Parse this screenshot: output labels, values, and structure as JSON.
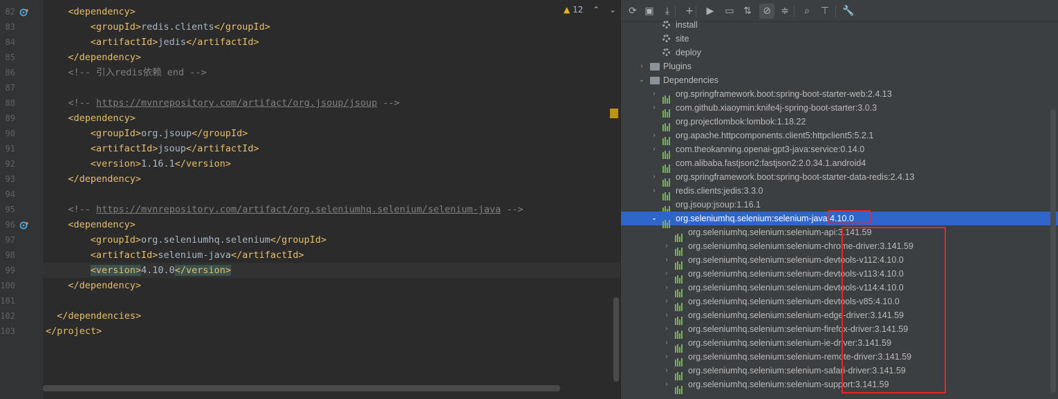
{
  "editor": {
    "inspection": {
      "count": "12",
      "warn_icon": "warning-icon"
    },
    "lines": [
      {
        "num": "82",
        "parts": [
          [
            "tag",
            "<dependency>"
          ]
        ],
        "indent": 4,
        "icon": "override-icon"
      },
      {
        "num": "83",
        "parts": [
          [
            "tag",
            "<groupId>"
          ],
          [
            "txt",
            "redis.clients"
          ],
          [
            "tag",
            "</groupId>"
          ]
        ],
        "indent": 8
      },
      {
        "num": "84",
        "parts": [
          [
            "tag",
            "<artifactId>"
          ],
          [
            "txt",
            "jedis"
          ],
          [
            "tag",
            "</artifactId>"
          ]
        ],
        "indent": 8
      },
      {
        "num": "85",
        "parts": [
          [
            "tag",
            "</dependency>"
          ]
        ],
        "indent": 4
      },
      {
        "num": "86",
        "parts": [
          [
            "cmt",
            "<!-- 引入redis依赖 end -->"
          ]
        ],
        "indent": 4
      },
      {
        "num": "87",
        "parts": [],
        "indent": 0
      },
      {
        "num": "88",
        "parts": [
          [
            "cmt",
            "<!-- "
          ],
          [
            "link",
            "https://mvnrepository.com/artifact/org.jsoup/jsoup"
          ],
          [
            "cmt",
            " -->"
          ]
        ],
        "indent": 4
      },
      {
        "num": "89",
        "parts": [
          [
            "tag",
            "<dependency>"
          ]
        ],
        "indent": 4
      },
      {
        "num": "90",
        "parts": [
          [
            "tag",
            "<groupId>"
          ],
          [
            "txt",
            "org.jsoup"
          ],
          [
            "tag",
            "</groupId>"
          ]
        ],
        "indent": 8
      },
      {
        "num": "91",
        "parts": [
          [
            "tag",
            "<artifactId>"
          ],
          [
            "txt",
            "jsoup"
          ],
          [
            "tag",
            "</artifactId>"
          ]
        ],
        "indent": 8
      },
      {
        "num": "92",
        "parts": [
          [
            "tag",
            "<version>"
          ],
          [
            "txt",
            "1.16.1"
          ],
          [
            "tag",
            "</version>"
          ]
        ],
        "indent": 8
      },
      {
        "num": "93",
        "parts": [
          [
            "tag",
            "</dependency>"
          ]
        ],
        "indent": 4
      },
      {
        "num": "94",
        "parts": [],
        "indent": 0
      },
      {
        "num": "95",
        "parts": [
          [
            "cmt",
            "<!-- "
          ],
          [
            "link",
            "https://mvnrepository.com/artifact/org.seleniumhq.selenium/selenium-java"
          ],
          [
            "cmt",
            " -->"
          ]
        ],
        "indent": 4
      },
      {
        "num": "96",
        "parts": [
          [
            "tag",
            "<dependency>"
          ]
        ],
        "indent": 4,
        "icon": "override-icon"
      },
      {
        "num": "97",
        "parts": [
          [
            "tag",
            "<groupId>"
          ],
          [
            "txt",
            "org.seleniumhq.selenium"
          ],
          [
            "tag",
            "</groupId>"
          ]
        ],
        "indent": 8
      },
      {
        "num": "98",
        "parts": [
          [
            "tag",
            "<artifactId>"
          ],
          [
            "txt",
            "selenium-java"
          ],
          [
            "tag",
            "</artifactId>"
          ]
        ],
        "indent": 8
      },
      {
        "num": "99",
        "parts": [
          [
            "hltag",
            "<version>"
          ],
          [
            "txt",
            "4.10.0"
          ],
          [
            "hltag",
            "</version>"
          ]
        ],
        "indent": 8,
        "current": true
      },
      {
        "num": "100",
        "parts": [
          [
            "tag",
            "</dependency>"
          ]
        ],
        "indent": 4
      },
      {
        "num": "101",
        "parts": [],
        "indent": 0
      },
      {
        "num": "102",
        "parts": [
          [
            "tag",
            "</dependencies>"
          ]
        ],
        "indent": 2
      },
      {
        "num": "103",
        "parts": [
          [
            "tag",
            "</project>"
          ]
        ],
        "indent": 0
      }
    ]
  },
  "maven": {
    "toolbar": [
      {
        "name": "reload-icon",
        "glyph": "⟳"
      },
      {
        "name": "generate-sources-icon",
        "glyph": "▣"
      },
      {
        "name": "download-icon",
        "glyph": "⤓"
      },
      {
        "name": "add-icon",
        "glyph": "+"
      },
      {
        "name": "run-icon",
        "glyph": "▶"
      },
      {
        "name": "execute-goal-icon",
        "glyph": "▭"
      },
      {
        "name": "toggle-offline-icon",
        "glyph": "⇅"
      },
      {
        "name": "skip-tests-icon",
        "glyph": "⊘"
      },
      {
        "name": "collapse-all-icon",
        "glyph": "≑"
      },
      {
        "name": "dependency-analyzer-icon",
        "glyph": "⌕"
      },
      {
        "name": "show-diagram-icon",
        "glyph": "⊤"
      },
      {
        "name": "settings-wrench-icon",
        "glyph": "🔧"
      }
    ],
    "tree": [
      {
        "label": "install",
        "level": 3,
        "icon": "gear-icon",
        "arrow": ""
      },
      {
        "label": "site",
        "level": 3,
        "icon": "gear-icon",
        "arrow": ""
      },
      {
        "label": "deploy",
        "level": 3,
        "icon": "gear-icon",
        "arrow": ""
      },
      {
        "label": "Plugins",
        "level": 2,
        "icon": "folder-icon",
        "arrow": "›"
      },
      {
        "label": "Dependencies",
        "level": 2,
        "icon": "folder-icon",
        "arrow": "⌄"
      },
      {
        "label": "org.springframework.boot:spring-boot-starter-web:2.4.13",
        "level": 3,
        "icon": "library-icon",
        "arrow": "›"
      },
      {
        "label": "com.github.xiaoymin:knife4j-spring-boot-starter:3.0.3",
        "level": 3,
        "icon": "library-icon",
        "arrow": "›"
      },
      {
        "label": "org.projectlombok:lombok:1.18.22",
        "level": 3,
        "icon": "library-icon",
        "arrow": ""
      },
      {
        "label": "org.apache.httpcomponents.client5:httpclient5:5.2.1",
        "level": 3,
        "icon": "library-icon",
        "arrow": "›"
      },
      {
        "label": "com.theokanning.openai-gpt3-java:service:0.14.0",
        "level": 3,
        "icon": "library-icon",
        "arrow": "›"
      },
      {
        "label": "com.alibaba.fastjson2:fastjson2:2.0.34.1.android4",
        "level": 3,
        "icon": "library-icon",
        "arrow": ""
      },
      {
        "label": "org.springframework.boot:spring-boot-starter-data-redis:2.4.13",
        "level": 3,
        "icon": "library-icon",
        "arrow": "›"
      },
      {
        "label": "redis.clients:jedis:3.3.0",
        "level": 3,
        "icon": "library-icon",
        "arrow": "›"
      },
      {
        "label": "org.jsoup:jsoup:1.16.1",
        "level": 3,
        "icon": "library-icon",
        "arrow": ""
      },
      {
        "label": "org.seleniumhq.selenium:selenium-java:4.10.0",
        "level": 3,
        "icon": "library-icon",
        "arrow": "⌄",
        "selected": true
      },
      {
        "label": "org.seleniumhq.selenium:selenium-api:3.141.59",
        "level": 4,
        "icon": "library-icon",
        "arrow": ""
      },
      {
        "label": "org.seleniumhq.selenium:selenium-chrome-driver:3.141.59",
        "level": 4,
        "icon": "library-icon",
        "arrow": "›"
      },
      {
        "label": "org.seleniumhq.selenium:selenium-devtools-v112:4.10.0",
        "level": 4,
        "icon": "library-icon",
        "arrow": "›"
      },
      {
        "label": "org.seleniumhq.selenium:selenium-devtools-v113:4.10.0",
        "level": 4,
        "icon": "library-icon",
        "arrow": "›"
      },
      {
        "label": "org.seleniumhq.selenium:selenium-devtools-v114:4.10.0",
        "level": 4,
        "icon": "library-icon",
        "arrow": "›"
      },
      {
        "label": "org.seleniumhq.selenium:selenium-devtools-v85:4.10.0",
        "level": 4,
        "icon": "library-icon",
        "arrow": "›"
      },
      {
        "label": "org.seleniumhq.selenium:selenium-edge-driver:3.141.59",
        "level": 4,
        "icon": "library-icon",
        "arrow": "›"
      },
      {
        "label": "org.seleniumhq.selenium:selenium-firefox-driver:3.141.59",
        "level": 4,
        "icon": "library-icon",
        "arrow": "›"
      },
      {
        "label": "org.seleniumhq.selenium:selenium-ie-driver:3.141.59",
        "level": 4,
        "icon": "library-icon",
        "arrow": "›"
      },
      {
        "label": "org.seleniumhq.selenium:selenium-remote-driver:3.141.59",
        "level": 4,
        "icon": "library-icon",
        "arrow": "›"
      },
      {
        "label": "org.seleniumhq.selenium:selenium-safari-driver:3.141.59",
        "level": 4,
        "icon": "library-icon",
        "arrow": "›"
      },
      {
        "label": "org.seleniumhq.selenium:selenium-support:3.141.59",
        "level": 4,
        "icon": "library-icon",
        "arrow": "›"
      }
    ]
  },
  "colors": {
    "selection": "#2f65ca",
    "annotation": "#e52727",
    "xml_tag": "#e8bf6a",
    "comment": "#808080"
  }
}
